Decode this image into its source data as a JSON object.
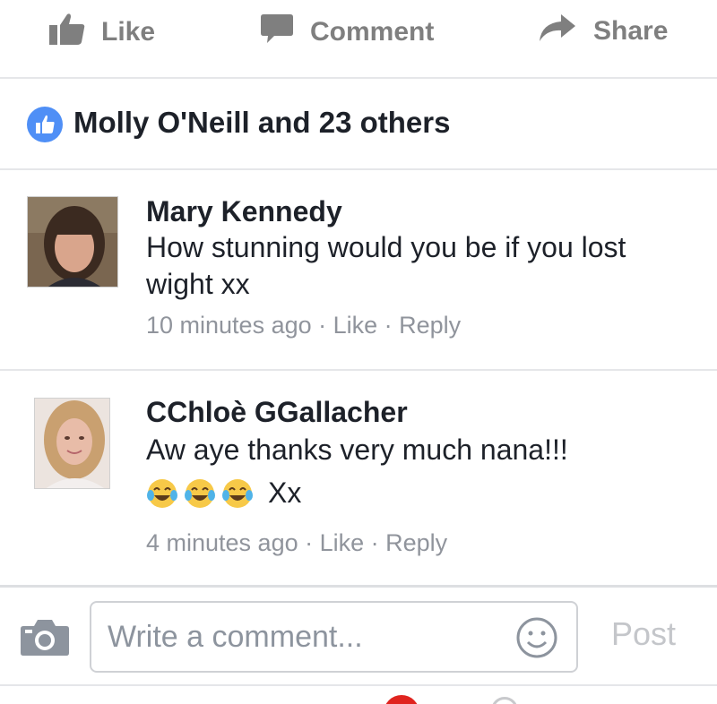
{
  "actions": {
    "like_label": "Like",
    "comment_label": "Comment",
    "share_label": "Share"
  },
  "likes": {
    "summary": "Molly O'Neill and 23 others"
  },
  "comments": [
    {
      "author": "Mary Kennedy",
      "text": "How stunning would you be if you lost wight xx",
      "time": "10 minutes ago",
      "like_label": "Like",
      "reply_label": "Reply"
    },
    {
      "author": "CChloè GGallacher",
      "text": "Aw aye thanks very much nana!!!",
      "emoji_suffix": "Xx",
      "emoji_icon": "face-with-tears-of-joy-emoji",
      "emoji_count": 3,
      "time": "4 minutes ago",
      "like_label": "Like",
      "reply_label": "Reply"
    }
  ],
  "composer": {
    "placeholder": "Write a comment...",
    "post_label": "Post"
  },
  "colors": {
    "accent": "#4f8ff6",
    "muted_text": "#90949c",
    "action_grey": "#7f7f7f"
  }
}
